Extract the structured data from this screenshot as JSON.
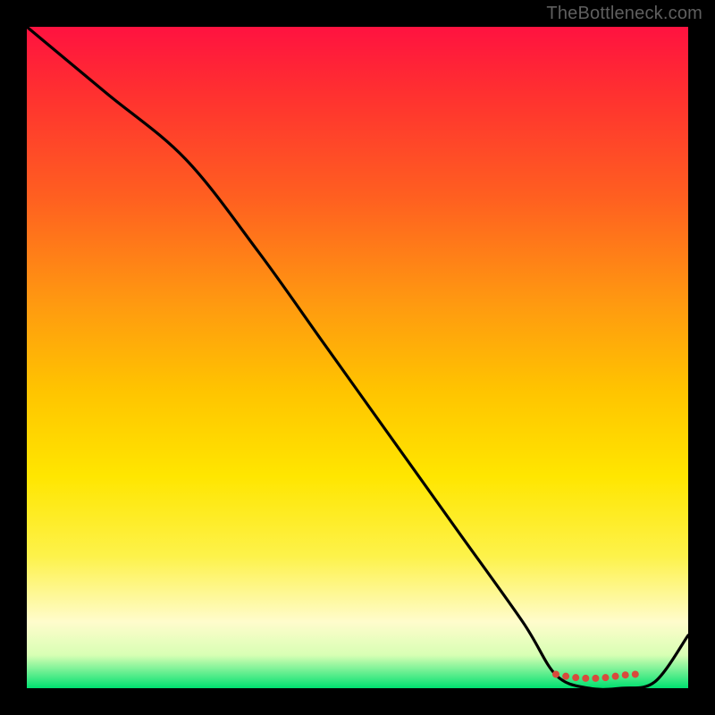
{
  "watermark": "TheBottleneck.com",
  "chart_data": {
    "type": "line",
    "title": "",
    "xlabel": "",
    "ylabel": "",
    "xlim": [
      0,
      100
    ],
    "ylim": [
      0,
      100
    ],
    "gradient_stops": [
      {
        "pos": 0,
        "color": "#ff1240"
      },
      {
        "pos": 10,
        "color": "#ff3030"
      },
      {
        "pos": 26,
        "color": "#ff6020"
      },
      {
        "pos": 42,
        "color": "#ff9a10"
      },
      {
        "pos": 55,
        "color": "#ffc400"
      },
      {
        "pos": 68,
        "color": "#ffe600"
      },
      {
        "pos": 80,
        "color": "#fdf24a"
      },
      {
        "pos": 90,
        "color": "#fffccc"
      },
      {
        "pos": 95,
        "color": "#d8ffb4"
      },
      {
        "pos": 100,
        "color": "#00e070"
      }
    ],
    "series": [
      {
        "name": "curve",
        "x": [
          0,
          12,
          24,
          35,
          45,
          55,
          65,
          75,
          80,
          85,
          90,
          95,
          100
        ],
        "values": [
          100,
          90,
          80,
          66,
          52,
          38,
          24,
          10,
          2,
          0,
          0,
          1,
          8
        ]
      }
    ],
    "markers": {
      "shape": "circle",
      "color": "#d84a3c",
      "radius": 4,
      "points": [
        {
          "x": 80,
          "y": 2.1
        },
        {
          "x": 81.5,
          "y": 1.8
        },
        {
          "x": 83,
          "y": 1.6
        },
        {
          "x": 84.5,
          "y": 1.5
        },
        {
          "x": 86,
          "y": 1.5
        },
        {
          "x": 87.5,
          "y": 1.6
        },
        {
          "x": 89,
          "y": 1.8
        },
        {
          "x": 90.5,
          "y": 2.0
        },
        {
          "x": 92,
          "y": 2.1
        }
      ]
    }
  }
}
